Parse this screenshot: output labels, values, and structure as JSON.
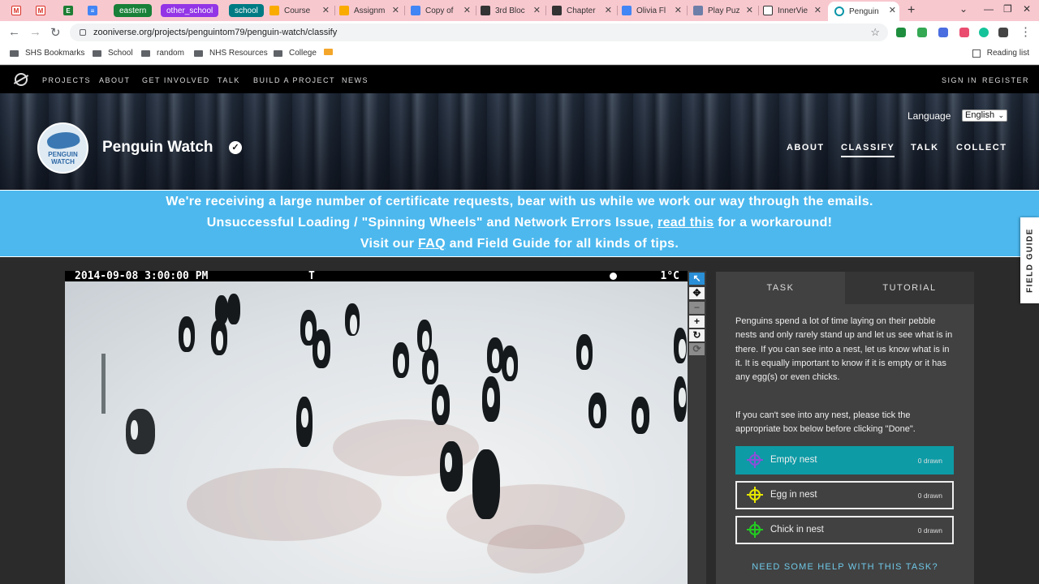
{
  "browser": {
    "tabs": [
      {
        "label": "",
        "kind": "gmail"
      },
      {
        "label": "",
        "kind": "gmail"
      },
      {
        "label": "",
        "kind": "evernote"
      },
      {
        "label": "",
        "kind": "docs"
      },
      {
        "label": "eastern",
        "kind": "group",
        "color": "#188038"
      },
      {
        "label": "other_school",
        "kind": "group",
        "color": "#9334e6"
      },
      {
        "label": "school",
        "kind": "group",
        "color": "#007b83"
      },
      {
        "label": "Course",
        "kind": "classroom"
      },
      {
        "label": "Assignm",
        "kind": "classroom"
      },
      {
        "label": "Copy of",
        "kind": "docs"
      },
      {
        "label": "3rd Bloc",
        "kind": "generic"
      },
      {
        "label": "Chapter",
        "kind": "generic"
      },
      {
        "label": "Olivia Fl",
        "kind": "docs"
      },
      {
        "label": "Play Puz",
        "kind": "puzzle"
      },
      {
        "label": "InnerVie",
        "kind": "panda"
      },
      {
        "label": "Penguin",
        "kind": "zooniverse",
        "active": true
      }
    ],
    "url": "zooniverse.org/projects/penguintom79/penguin-watch/classify",
    "bookmarks": [
      "SHS Bookmarks",
      "School",
      "random",
      "NHS Resources",
      "College"
    ],
    "reading_list": "Reading list"
  },
  "zooniverse_nav": {
    "items": [
      "PROJECTS",
      "ABOUT",
      "GET INVOLVED",
      "TALK",
      "BUILD A PROJECT",
      "NEWS"
    ],
    "sign_in": "SIGN IN",
    "register": "REGISTER"
  },
  "project": {
    "title": "Penguin Watch",
    "avatar_text_1": "PENGUIN",
    "avatar_text_2": "WATCH",
    "language_label": "Language",
    "language_value": "English",
    "nav": [
      "ABOUT",
      "CLASSIFY",
      "TALK",
      "COLLECT"
    ],
    "active_nav": "CLASSIFY"
  },
  "announcement": {
    "line1": "We're receiving a large number of certificate requests, bear with us while we work our way through the emails.",
    "line2_pre": "Unsuccessful Loading / \"Spinning Wheels\" and Network Errors Issue, ",
    "line2_link": "read this",
    "line2_post": " for a workaround!",
    "line3_pre": "Visit our ",
    "line3_link": "FAQ",
    "line3_post": " and Field Guide for all kinds of tips."
  },
  "subject": {
    "timestamp": "2014-09-08 3:00:00 PM",
    "flag": "T",
    "temperature": "1°C"
  },
  "task_panel": {
    "tabs": [
      "TASK",
      "TUTORIAL"
    ],
    "instructions_1": "Penguins spend a lot of time laying on their pebble nests and only rarely stand up and let us see what is in there. If you can see into a nest, let us know what is in it. It is equally important to know if it is empty or it has any egg(s) or even chicks.",
    "instructions_2": "If you can't see into any nest, please tick the appropriate box below before clicking \"Done\".",
    "choices": [
      {
        "label": "Empty nest",
        "count": "0 drawn",
        "color": "#8a4fd8",
        "checked": true
      },
      {
        "label": "Egg in nest",
        "count": "0 drawn",
        "color": "#e6e600",
        "checked": false
      },
      {
        "label": "Chick in nest",
        "count": "0 drawn",
        "color": "#22cc22",
        "checked": false
      }
    ],
    "help": "NEED SOME HELP WITH THIS TASK?"
  },
  "field_guide": "FIELD GUIDE"
}
